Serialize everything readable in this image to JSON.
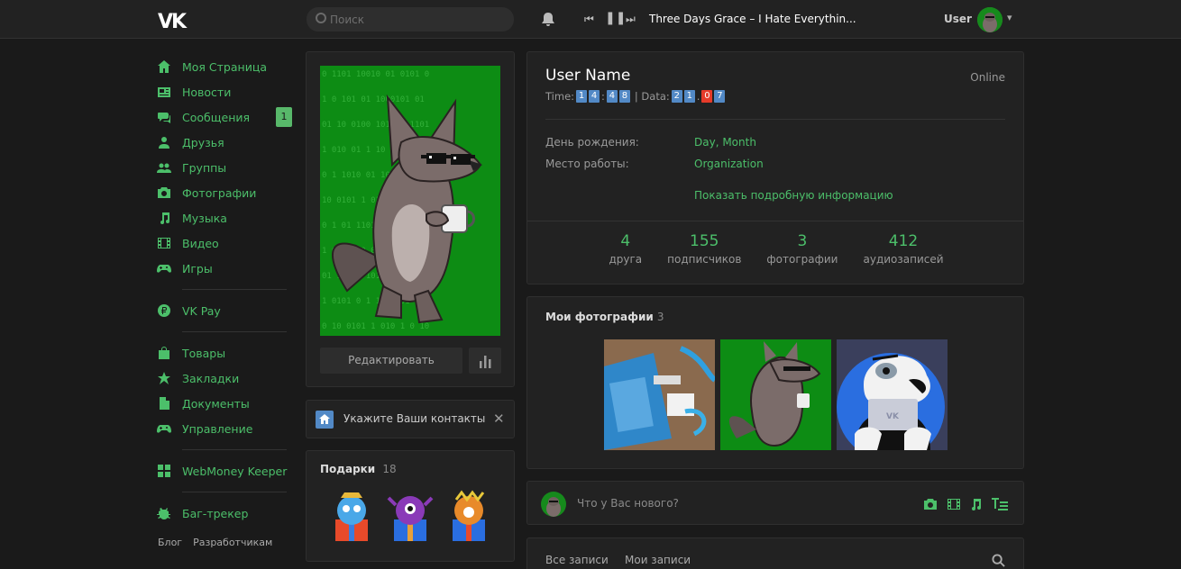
{
  "header": {
    "search_placeholder": "Поиск",
    "track_title": "Three Days Grace – I Hate Everythin...",
    "user_label": "User"
  },
  "sidebar": {
    "items": [
      {
        "label": "Моя Страница",
        "icon": "home-icon"
      },
      {
        "label": "Новости",
        "icon": "news-icon"
      },
      {
        "label": "Сообщения",
        "icon": "messages-icon",
        "badge": "1"
      },
      {
        "label": "Друзья",
        "icon": "friends-icon"
      },
      {
        "label": "Группы",
        "icon": "groups-icon"
      },
      {
        "label": "Фотографии",
        "icon": "camera-icon"
      },
      {
        "label": "Музыка",
        "icon": "music-icon"
      },
      {
        "label": "Видео",
        "icon": "video-icon"
      },
      {
        "label": "Игры",
        "icon": "gamepad-icon"
      }
    ],
    "vkpay": "VK Pay",
    "items2": [
      {
        "label": "Товары",
        "icon": "bag-icon"
      },
      {
        "label": "Закладки",
        "icon": "star-icon"
      },
      {
        "label": "Документы",
        "icon": "document-icon"
      },
      {
        "label": "Управление",
        "icon": "gamepad-icon"
      }
    ],
    "webmoney": "WebMoney Keeper",
    "bugtracker": "Баг-трекер",
    "footer": [
      "Блог",
      "Разработчикам"
    ]
  },
  "profile": {
    "edit_button": "Редактировать",
    "contacts_prompt": "Укажите Ваши контакты",
    "gifts_label": "Подарки",
    "gifts_count": "18",
    "name": "User Name",
    "status": "Online",
    "time_label": "Time:",
    "time_digits": [
      "1",
      "4",
      "4",
      "8"
    ],
    "data_label": "| Data:",
    "data_digits": [
      "2",
      "1",
      "0",
      "7"
    ],
    "birthday_label": "День рождения:",
    "birthday_value": "Day, Month",
    "work_label": "Место работы:",
    "work_value": "Organization",
    "more_info": "Показать подробную информацию",
    "counters": [
      {
        "value": "4",
        "label": "друга"
      },
      {
        "value": "155",
        "label": "подписчиков"
      },
      {
        "value": "3",
        "label": "фотографии"
      },
      {
        "value": "412",
        "label": "аудиозаписей"
      }
    ],
    "photos_label": "Мои фотографии",
    "photos_count": "3",
    "post_placeholder": "Что у Вас нового?",
    "wall_tabs": [
      "Все записи",
      "Мои записи"
    ]
  },
  "colors": {
    "accent": "#4cbf6a",
    "background": "#1a1a1a",
    "panel": "#222222",
    "digit": "#5289c6",
    "digit_red": "#e63b2a"
  }
}
